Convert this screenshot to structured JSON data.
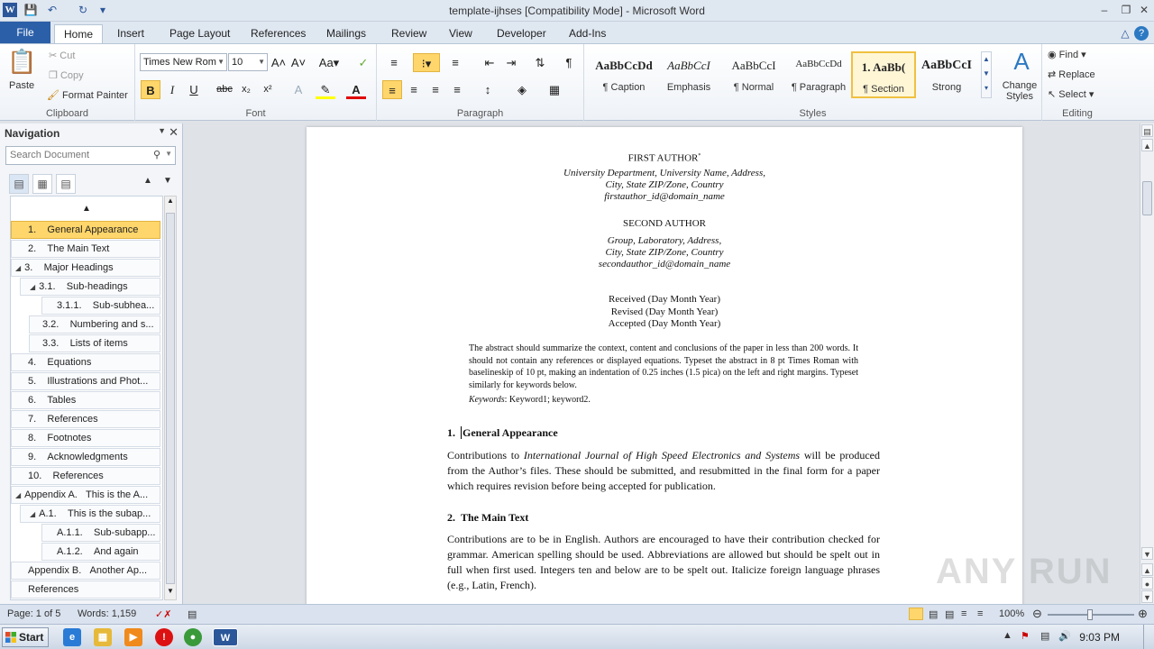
{
  "titlebar": {
    "title": "template-ijhses [Compatibility Mode]  -  Microsoft Word"
  },
  "tabs": [
    "File",
    "Home",
    "Insert",
    "Page Layout",
    "References",
    "Mailings",
    "Review",
    "View",
    "Developer",
    "Add-Ins"
  ],
  "clipboard": {
    "paste": "Paste",
    "cut": "Cut",
    "copy": "Copy",
    "format_painter": "Format Painter",
    "label": "Clipboard"
  },
  "font": {
    "name": "Times New Rom",
    "size": "10",
    "label": "Font"
  },
  "paragraph": {
    "label": "Paragraph"
  },
  "styles": {
    "label": "Styles",
    "items": [
      {
        "preview": "AaBbCcDd",
        "name": "¶ Caption"
      },
      {
        "preview": "AaBbCcI",
        "name": "Emphasis"
      },
      {
        "preview": "AaBbCcI",
        "name": "¶ Normal"
      },
      {
        "preview": "AaBbCcDd",
        "name": "¶ Paragraph"
      },
      {
        "preview": "1.  AaBb(",
        "name": "¶ Section"
      },
      {
        "preview": "AaBbCcI",
        "name": "Strong"
      }
    ],
    "change": "Change Styles"
  },
  "editing": {
    "label": "Editing",
    "find": "Find",
    "replace": "Replace",
    "select": "Select"
  },
  "nav": {
    "title": "Navigation",
    "search_placeholder": "Search Document",
    "items": [
      {
        "num": "1.",
        "text": "General Appearance"
      },
      {
        "num": "2.",
        "text": "The Main Text"
      },
      {
        "num": "3.",
        "text": "Major Headings"
      },
      {
        "num": "3.1.",
        "text": "Sub-headings"
      },
      {
        "num": "3.1.1.",
        "text": "Sub-subhea..."
      },
      {
        "num": "3.2.",
        "text": "Numbering and s..."
      },
      {
        "num": "3.3.",
        "text": "Lists of items"
      },
      {
        "num": "4.",
        "text": "Equations"
      },
      {
        "num": "5.",
        "text": "Illustrations and Phot..."
      },
      {
        "num": "6.",
        "text": "Tables"
      },
      {
        "num": "7.",
        "text": "References"
      },
      {
        "num": "8.",
        "text": "Footnotes"
      },
      {
        "num": "9.",
        "text": "Acknowledgments"
      },
      {
        "num": "10.",
        "text": "References"
      },
      {
        "num": "Appendix A.",
        "text": "This is the A..."
      },
      {
        "num": "A.1.",
        "text": "This is the subap..."
      },
      {
        "num": "A.1.1.",
        "text": "Sub-subapp..."
      },
      {
        "num": "A.1.2.",
        "text": "And again"
      },
      {
        "num": "Appendix B.",
        "text": "Another Ap..."
      },
      {
        "num": "",
        "text": "References"
      }
    ]
  },
  "doc": {
    "author1": "FIRST AUTHOR",
    "affil1_line1": "University Department, University Name, Address,",
    "affil1_line2": "City, State ZIP/Zone, Country",
    "email1": "firstauthor_id@domain_name",
    "author2": "SECOND AUTHOR",
    "affil2_line1": "Group, Laboratory, Address,",
    "affil2_line2": "City, State ZIP/Zone, Country",
    "email2": "secondauthor_id@domain_name",
    "received": "Received (Day Month Year)",
    "revised": "Revised (Day Month Year)",
    "accepted": "Accepted (Day Month Year)",
    "abstract": "The abstract should summarize the context, content and conclusions of the paper in less than 200 words. It should not contain any references or displayed equations. Typeset the abstract in 8 pt Times Roman with baselineskip of 10 pt, making an indentation of 0.25 inches (1.5 pica) on the left and right margins. Typeset similarly for keywords below.",
    "keywords_label": "Keywords",
    "keywords": ": Keyword1; keyword2.",
    "h1_num": "1.",
    "h1": "General Appearance",
    "p1_a": "Contributions to ",
    "p1_journal": "International Journal of High Speed Electronics and Systems",
    "p1_b": " will be produced from the Author’s files. These should be submitted, and resubmitted in the final form for a paper which requires revision before being accepted for publication.",
    "h2_num": "2.",
    "h2": "The Main Text",
    "p2": "Contributions are to be in English. Authors are encouraged to have their contribution checked for grammar. American spelling should be used. Abbreviations are allowed but should be spelt out in full when first used. Integers ten and below are to be spelt out. Italicize foreign language phrases (e.g., Latin, French)."
  },
  "status": {
    "page": "Page: 1 of 5",
    "words": "Words: 1,159",
    "zoom": "100%"
  },
  "taskbar": {
    "start": "Start",
    "time": "9:03 PM"
  },
  "watermark": "ANY RUN"
}
